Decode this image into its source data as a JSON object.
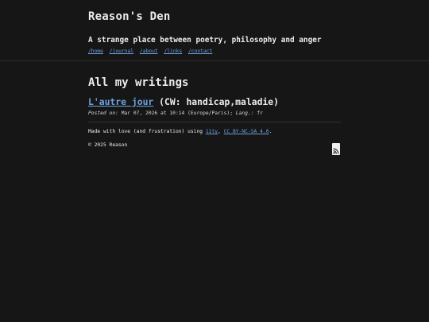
{
  "site": {
    "title": "Reason's Den",
    "subtitle": "A strange place between poetry, philosophy and anger"
  },
  "nav": {
    "items": [
      "/home",
      "/journal",
      "/about",
      "/links",
      "/contact"
    ]
  },
  "main": {
    "heading": "All my writings",
    "posts": [
      {
        "title": "L'autre jour",
        "cw": "(CW: handicap,maladie)",
        "posted_label": "Posted on:",
        "date": "Mar 07, 2026 at 10:14 (Europe/Paris);",
        "lang_label": "Lang.:",
        "lang": "fr"
      }
    ]
  },
  "footer": {
    "made_text": "Made with love (and frustration) using",
    "tool_link": "11ty",
    "license_link": "CC BY-NC-SA 4.0",
    "end_punct": ".",
    "copyright": "© 2025 Reason",
    "rss_icon": "rss-icon"
  }
}
